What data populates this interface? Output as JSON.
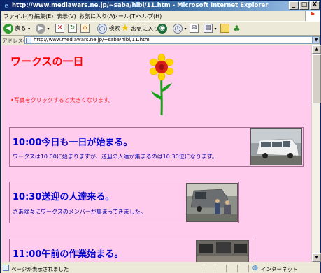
{
  "window": {
    "title": "http://www.mediawars.ne.jp/~saba/hibi/11.htm - Microsoft Internet Explorer",
    "minimize": "_",
    "maximize": "□",
    "close": "X"
  },
  "menu": {
    "file": "ファイル(F)",
    "edit": "編集(E)",
    "view": "表示(V)",
    "favorites": "お気に入り(A)",
    "tools": "ツール(T)",
    "help": "ヘルプ(H)"
  },
  "toolbar": {
    "back": "戻る",
    "search": "検索",
    "favorites": "お気に入り"
  },
  "address": {
    "label": "アドレス(D)",
    "url": "http://www.mediawars.ne.jp/~saba/hibi/11.htm"
  },
  "page": {
    "title": "ワークスの一日",
    "hint": "•写真をクリックすると大きくなります。",
    "sections": [
      {
        "title": "10:00今日も一日が始まる。",
        "text": "ワークスは10:00に始まりますが、送迎の人達が集まるのは10:30位になります。"
      },
      {
        "title": "10:30送迎の人達来る。",
        "text": "さあ除々にワークスのメンバーが集まってきました。"
      },
      {
        "title": "11:00午前の作業始まる。",
        "text": ""
      }
    ]
  },
  "status": {
    "left": "ページが表示されました",
    "zone": "インターネット"
  }
}
